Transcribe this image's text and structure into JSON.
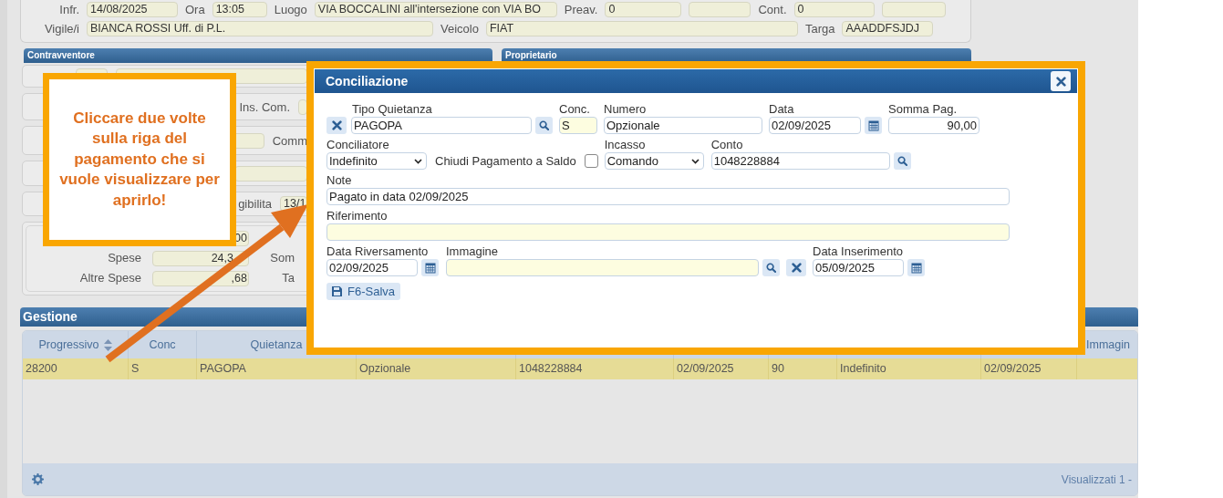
{
  "record": {
    "infraction_line": [
      {
        "label": "Infr.",
        "value": "14/08/2025"
      },
      {
        "label": "Ora",
        "value": "13:05"
      },
      {
        "label": "Luogo",
        "value": "VIA BOCCALINI all'intersezione con VIA BO"
      },
      {
        "label": "Preav.",
        "value": "0"
      },
      {
        "kind": "blank_field"
      },
      {
        "label": "Cont.",
        "value": "0"
      },
      {
        "kind": "blank_field"
      }
    ],
    "officer_line": [
      {
        "label": "Vigile/i",
        "value": "BIANCA ROSSI Uff. di P.L."
      },
      {
        "label": "Veicolo",
        "value": "FIAT"
      },
      {
        "label": "Targa",
        "value": "AAADDFSJDJ"
      }
    ]
  },
  "panels": [
    {
      "title": "Contravventore"
    },
    {
      "title": "Proprietario"
    }
  ],
  "contravventore": {
    "rows": [
      [
        {
          "kind": "field"
        },
        {
          "kind": "field"
        }
      ],
      [
        {
          "kind": "label",
          "text": "Ins. Com."
        },
        {
          "kind": "field"
        }
      ],
      [
        {
          "kind": "field"
        },
        {
          "kind": "label",
          "text": "Comm"
        }
      ],
      [
        {
          "kind": "field"
        }
      ],
      [
        {
          "kind": "label",
          "text": "gibilita"
        },
        {
          "kind": "field",
          "value": "13/1"
        }
      ]
    ],
    "totals": [
      {
        "value": "00"
      },
      {
        "label": "Spese",
        "value": "24,3",
        "side": "Som"
      },
      {
        "label": "Altre Spese",
        "value": ",68",
        "side": "Ta"
      }
    ]
  },
  "callout": {
    "text": "Cliccare due volte sulla riga del pagamento che si vuole visualizzare per aprirlo!"
  },
  "dialog": {
    "title": "Conciliazione",
    "tipo_quietanza": {
      "label": "Tipo Quietanza",
      "value": "PAGOPA"
    },
    "conc": {
      "label": "Conc.",
      "value": "S",
      "required": true
    },
    "numero": {
      "label": "Numero",
      "value": "Opzionale"
    },
    "data": {
      "label": "Data",
      "value": "02/09/2025"
    },
    "somma": {
      "label": "Somma Pag.",
      "value": "90,00"
    },
    "conciliatore": {
      "label": "Conciliatore",
      "value": "Indefinito"
    },
    "chiudi": {
      "label": "Chiudi Pagamento a Saldo",
      "checked": false
    },
    "incasso": {
      "label": "Incasso",
      "value": "Comando"
    },
    "conto": {
      "label": "Conto",
      "value": "1048228884"
    },
    "note": {
      "label": "Note",
      "value": "Pagato in data 02/09/2025"
    },
    "riferimento": {
      "label": "Riferimento",
      "required": true
    },
    "data_riversamento": {
      "label": "Data Riversamento",
      "value": "02/09/2025"
    },
    "immagine": {
      "label": "Immagine",
      "required": true
    },
    "data_inserimento": {
      "label": "Data Inserimento",
      "value": "05/09/2025"
    },
    "save_button": "F6-Salva"
  },
  "gestione": {
    "title": "Gestione",
    "columns": [
      {
        "label": "Progressivo",
        "sorted": true
      },
      {
        "label": "Conc",
        "sorted": false
      },
      {
        "label": "Quietanza",
        "sorted": false
      },
      {},
      {},
      {},
      {},
      {},
      {},
      {
        "label": "Immagin",
        "sorted": false
      }
    ],
    "rows": [
      {
        "selected": true,
        "cells": [
          "28200",
          "S",
          "PAGOPA",
          "Opzionale",
          "1048228884",
          "02/09/2025",
          "90",
          "Indefinito",
          "02/09/2025"
        ]
      }
    ],
    "footer": "Visualizzati 1 -"
  }
}
